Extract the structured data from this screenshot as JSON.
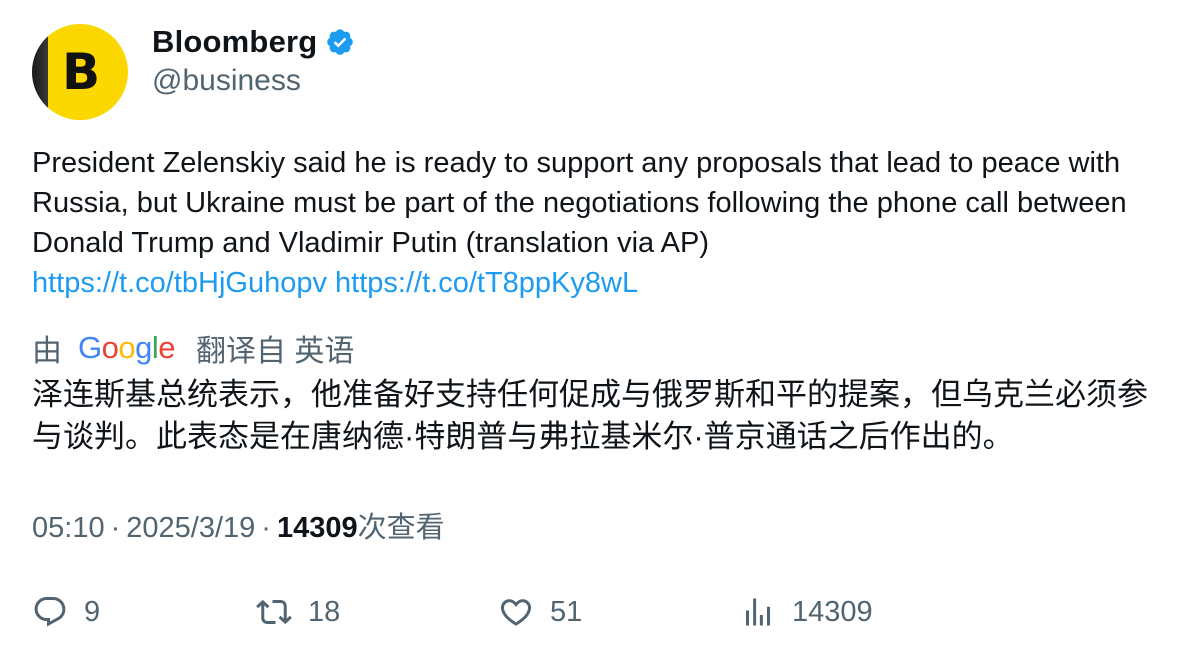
{
  "author": {
    "display_name": "Bloomberg",
    "handle": "@business",
    "avatar_letter": "B",
    "avatar_color": "#fcd800",
    "verified": true,
    "verified_color": "#1d9bf0"
  },
  "tweet": {
    "text": "President Zelenskiy said he is ready to support any proposals that lead to peace with Russia, but Ukraine must be part of the negotiations following the phone call between Donald Trump and Vladimir Putin (translation via AP)",
    "links": [
      "https://t.co/tbHjGuhopv",
      "https://t.co/tT8ppKy8wL"
    ],
    "link_color": "#1d9bf0"
  },
  "translation": {
    "prefix": "由",
    "provider": "Google",
    "suffix": "翻译自 英语",
    "text": "泽连斯基总统表示，他准备好支持任何促成与俄罗斯和平的提案，但乌克兰必须参与谈判。此表态是在唐纳德·特朗普与弗拉基米尔·普京通话之后作出的。"
  },
  "meta": {
    "time": "05:10",
    "date": "2025/3/19",
    "views_count": "14309",
    "views_label": "次查看"
  },
  "actions": {
    "replies": "9",
    "retweets": "18",
    "likes": "51",
    "views": "14309"
  },
  "icons": {
    "reply": "reply-icon",
    "retweet": "retweet-icon",
    "like": "heart-icon",
    "views": "views-icon",
    "verified": "verified-badge-icon"
  }
}
